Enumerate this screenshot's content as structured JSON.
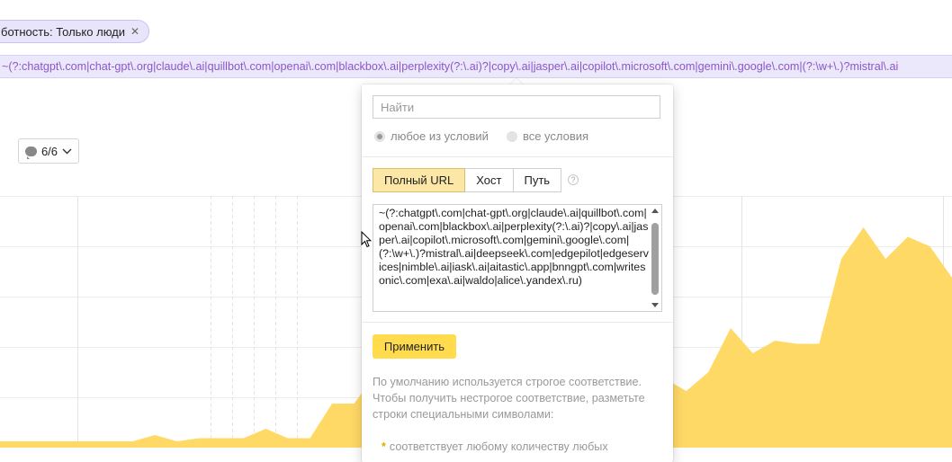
{
  "filter_chip": {
    "label": "ботность: Только люди",
    "close_glyph": "✕"
  },
  "segment_bar": {
    "text": "~(?:chatgpt\\.com|chat-gpt\\.org|claude\\.ai|quillbot\\.com|openai\\.com|blackbox\\.ai|perplexity(?:\\.ai)?|copy\\.ai|jasper\\.ai|copilot\\.microsoft\\.com|gemini\\.google\\.com|(?:\\w+\\.)?mistral\\.ai"
  },
  "comments_toggle": {
    "count": "6/6",
    "icon": "speech-bubble-icon",
    "caret": "chevron-down-icon"
  },
  "popup": {
    "search_placeholder": "Найти",
    "radio_any": "любое из условий",
    "radio_all": "все условия",
    "tabs": [
      "Полный URL",
      "Хост",
      "Путь"
    ],
    "active_tab": "Полный URL",
    "help_glyph": "?",
    "textarea_value": "~(?:chatgpt\\.com|chat-gpt\\.org|claude\\.ai|quillbot\\.com|openai\\.com|blackbox\\.ai|perplexity(?:\\.ai)?|copy\\.ai|jasper\\.ai|copilot\\.microsoft\\.com|gemini\\.google\\.com|(?:\\w+\\.)?mistral\\.ai|deepseek\\.com|edgepilot|edgeservices|nimble\\.ai|iask\\.ai|aitastic\\.app|bnngpt\\.com|writesonic\\.com|exa\\.ai|waldo|alice\\.yandex\\.ru)",
    "apply_label": "Применить",
    "hint_text": "По умолчанию используется строгое соответствие. Чтобы получить нестрогое соответствие, разметьте строки специальными символами:",
    "bullet_glyph": "*",
    "bullet_text": "соответствует любому количеству любых"
  },
  "colors": {
    "accent": "#ffdb4d",
    "chart_fill": "#ffd966",
    "chip_bg": "#e8e5fb",
    "segment_text": "#8b56c9"
  },
  "chart_data": {
    "type": "area",
    "x": [
      0,
      1,
      2,
      3,
      4,
      5,
      6,
      7,
      8,
      9,
      10,
      11,
      12,
      13,
      14,
      15,
      16,
      17,
      18,
      19,
      20,
      21,
      22,
      23,
      24,
      25,
      26,
      27,
      28,
      29,
      30,
      31,
      32,
      33,
      34,
      35,
      36,
      37,
      38,
      39,
      40,
      41,
      42,
      43
    ],
    "values": [
      2,
      2,
      2,
      2,
      2,
      2,
      2,
      4,
      2,
      3,
      3,
      3,
      6,
      3,
      3,
      14,
      14,
      24,
      18,
      22,
      23,
      20,
      18,
      20,
      18,
      18,
      17,
      18,
      18,
      19,
      22,
      18,
      24,
      38,
      30,
      34,
      33,
      33,
      60,
      70,
      60,
      67,
      64,
      54
    ],
    "ylim": [
      0,
      80
    ],
    "grid": true
  }
}
